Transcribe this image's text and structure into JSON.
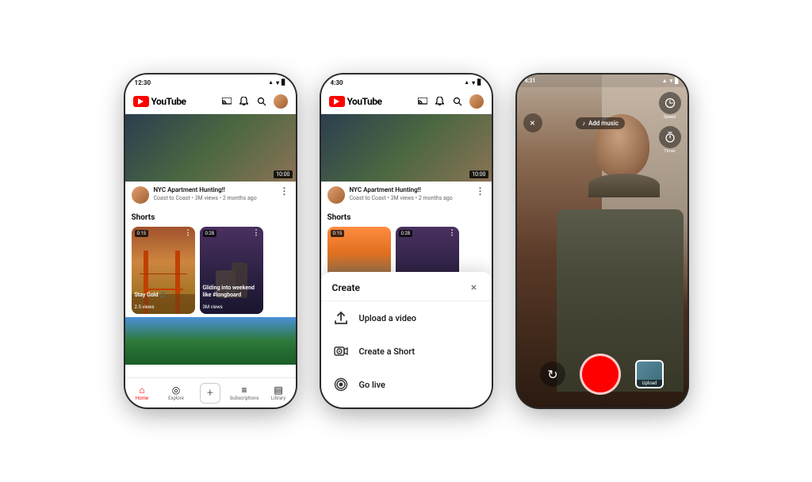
{
  "scene": {
    "background": "#ffffff"
  },
  "phone1": {
    "status": {
      "time": "12:30",
      "signal": "▲",
      "wifi": "WiFi",
      "battery": "Battery"
    },
    "header": {
      "logo_text": "YouTube",
      "cast_icon": "cast",
      "notification_icon": "bell",
      "search_icon": "search",
      "avatar_icon": "avatar"
    },
    "featured_video": {
      "duration": "10:00",
      "title": "NYC Apartment Hunting!!",
      "meta": "Coast to Coast • 3M views • 2 months ago"
    },
    "shorts": {
      "section_title": "Shorts",
      "items": [
        {
          "duration": "0:15",
          "title": "Stay Gold 🎵",
          "views": "2.5 views"
        },
        {
          "duration": "0:28",
          "title": "Gliding into weekend like #longboard",
          "views": "3M views"
        }
      ]
    },
    "nav": {
      "items": [
        {
          "label": "Home",
          "icon": "home",
          "active": true
        },
        {
          "label": "Explore",
          "icon": "explore",
          "active": false
        },
        {
          "label": "",
          "icon": "plus",
          "active": false
        },
        {
          "label": "Subscriptions",
          "icon": "subscriptions",
          "active": false
        },
        {
          "label": "Library",
          "icon": "library",
          "active": false
        }
      ]
    }
  },
  "phone2": {
    "status": {
      "time": "4:30",
      "signal": "▲",
      "wifi": "WiFi",
      "battery": "Battery"
    },
    "header": {
      "logo_text": "YouTube"
    },
    "featured_video": {
      "duration": "10:00",
      "title": "NYC Apartment Hunting!!",
      "meta": "Coast to Coast • 3M views • 2 months ago"
    },
    "shorts": {
      "section_title": "Shorts"
    },
    "modal": {
      "title": "Create",
      "close_label": "×",
      "items": [
        {
          "icon": "upload",
          "label": "Upload a video"
        },
        {
          "icon": "shorts-camera",
          "label": "Create a Short"
        },
        {
          "icon": "live",
          "label": "Go live"
        }
      ]
    }
  },
  "phone3": {
    "status": {
      "time": "4:31",
      "signal": "▲",
      "wifi": "WiFi",
      "battery": "Battery"
    },
    "camera": {
      "close_icon": "×",
      "add_music_label": "Add music",
      "speed_label": "Speed",
      "timer_label": "Timer",
      "flip_icon": "↻",
      "upload_label": "Upload"
    }
  }
}
